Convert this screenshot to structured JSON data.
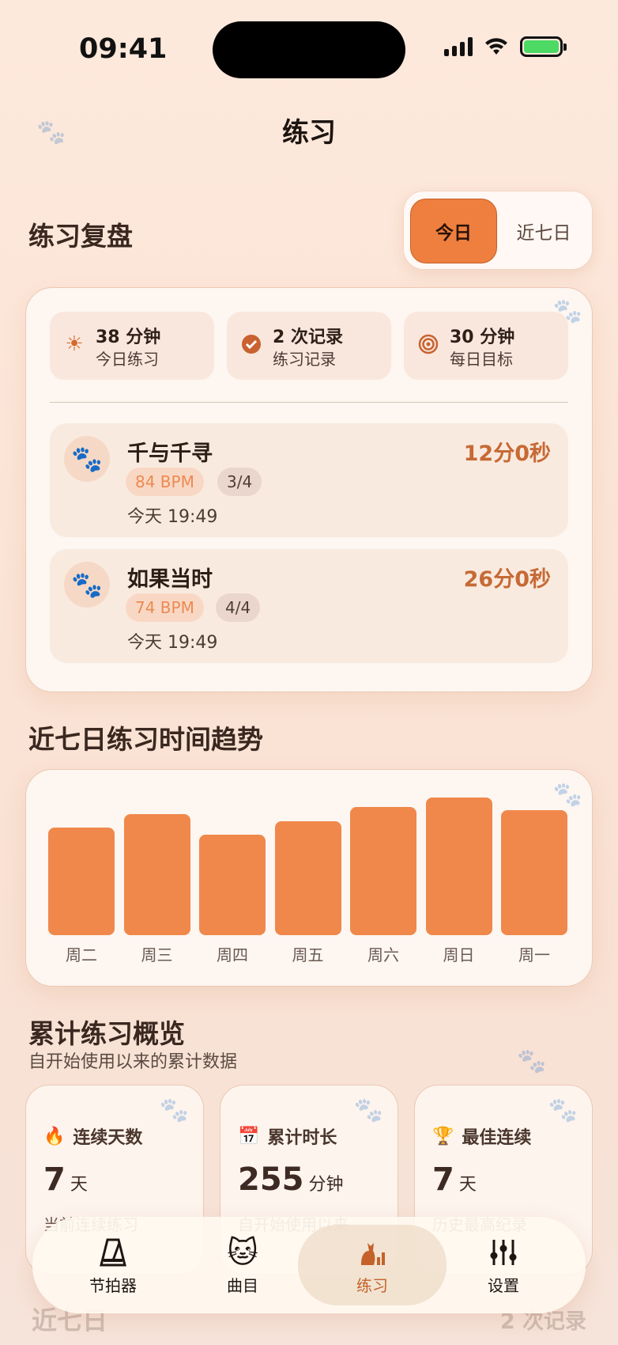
{
  "status_bar": {
    "time": "09:41"
  },
  "nav": {
    "title": "练习"
  },
  "review": {
    "title": "练习复盘",
    "segments": [
      "今日",
      "近七日"
    ],
    "stats": [
      {
        "icon": "sun-icon",
        "value": "38 分钟",
        "label": "今日练习"
      },
      {
        "icon": "check-circle-icon",
        "value": "2 次记录",
        "label": "练习记录"
      },
      {
        "icon": "target-icon",
        "value": "30 分钟",
        "label": "每日目标"
      }
    ],
    "records": [
      {
        "title": "千与千寻",
        "duration": "12分0秒",
        "bpm": "84 BPM",
        "time_signature": "3/4",
        "time": "今天 19:49"
      },
      {
        "title": "如果当时",
        "duration": "26分0秒",
        "bpm": "74 BPM",
        "time_signature": "4/4",
        "time": "今天 19:49"
      }
    ]
  },
  "trend": {
    "title": "近七日练习时间趋势",
    "chart_data": {
      "type": "bar",
      "categories": [
        "周二",
        "周三",
        "周四",
        "周五",
        "周六",
        "周日",
        "周一"
      ],
      "values": [
        0.78,
        0.88,
        0.73,
        0.83,
        0.93,
        1.0,
        0.91
      ],
      "ylim": [
        0,
        1
      ],
      "grid": false
    }
  },
  "overview": {
    "title": "累计练习概览",
    "subtitle": "自开始使用以来的累计数据",
    "cards": [
      {
        "icon": "flame-icon",
        "label": "连续天数",
        "value": "7",
        "unit": "天",
        "footer": "当前连续练习"
      },
      {
        "icon": "calendar-icon",
        "label": "累计时长",
        "value": "255",
        "unit": "分钟",
        "footer": "自开始使用以来"
      },
      {
        "icon": "trophy-icon",
        "label": "最佳连续",
        "value": "7",
        "unit": "天",
        "footer": "历史最高纪录"
      }
    ]
  },
  "peek": {
    "left": "近七日",
    "right": "2 次记录"
  },
  "tabbar": {
    "items": [
      {
        "label": "节拍器",
        "icon": "metronome-icon"
      },
      {
        "label": "曲目",
        "icon": "cat-music-icon"
      },
      {
        "label": "练习",
        "icon": "cat-chart-icon"
      },
      {
        "label": "设置",
        "icon": "sliders-icon"
      }
    ]
  },
  "colors": {
    "accent": "#ee7f3e",
    "bar": "#f0884b",
    "duration_text": "#c66a35"
  }
}
